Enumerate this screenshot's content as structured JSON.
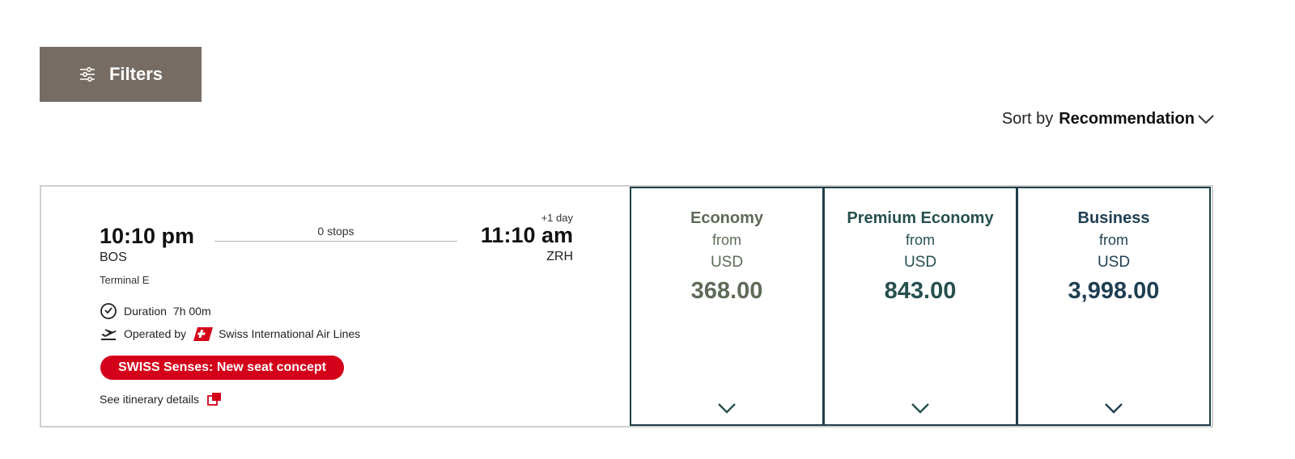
{
  "toolbar": {
    "filters_label": "Filters"
  },
  "sort": {
    "prefix": "Sort by",
    "value": "Recommendation"
  },
  "flight": {
    "departure": {
      "time": "10:10 pm",
      "airport": "BOS",
      "terminal": "Terminal E"
    },
    "stops": "0 stops",
    "arrival": {
      "time": "11:10 am",
      "airport": "ZRH",
      "day_offset": "+1 day"
    },
    "duration_label": "Duration",
    "duration_value": "7h 00m",
    "operated_by_label": "Operated by",
    "carrier": "Swiss International Air Lines",
    "badge": "SWISS Senses: New seat concept",
    "itinerary_link": "See itinerary details"
  },
  "fares": [
    {
      "cabin": "Economy",
      "from": "from",
      "currency": "USD",
      "price": "368.00",
      "color": "#5e6b58"
    },
    {
      "cabin": "Premium Economy",
      "from": "from",
      "currency": "USD",
      "price": "843.00",
      "color": "#27504f"
    },
    {
      "cabin": "Business",
      "from": "from",
      "currency": "USD",
      "price": "3,998.00",
      "color": "#1f3f52"
    }
  ],
  "colors": {
    "filters_bg": "#766c63",
    "badge_bg": "#d4001a",
    "fare_border": "#1f3f4a"
  },
  "icons": {
    "filters": "sliders-icon",
    "sort": "chevron-down-icon",
    "duration": "clock-icon",
    "operated": "plane-takeoff-icon",
    "carrier": "swiss-logo-icon",
    "itinerary": "external-link-icon",
    "fare_expand": "chevron-down-icon"
  }
}
